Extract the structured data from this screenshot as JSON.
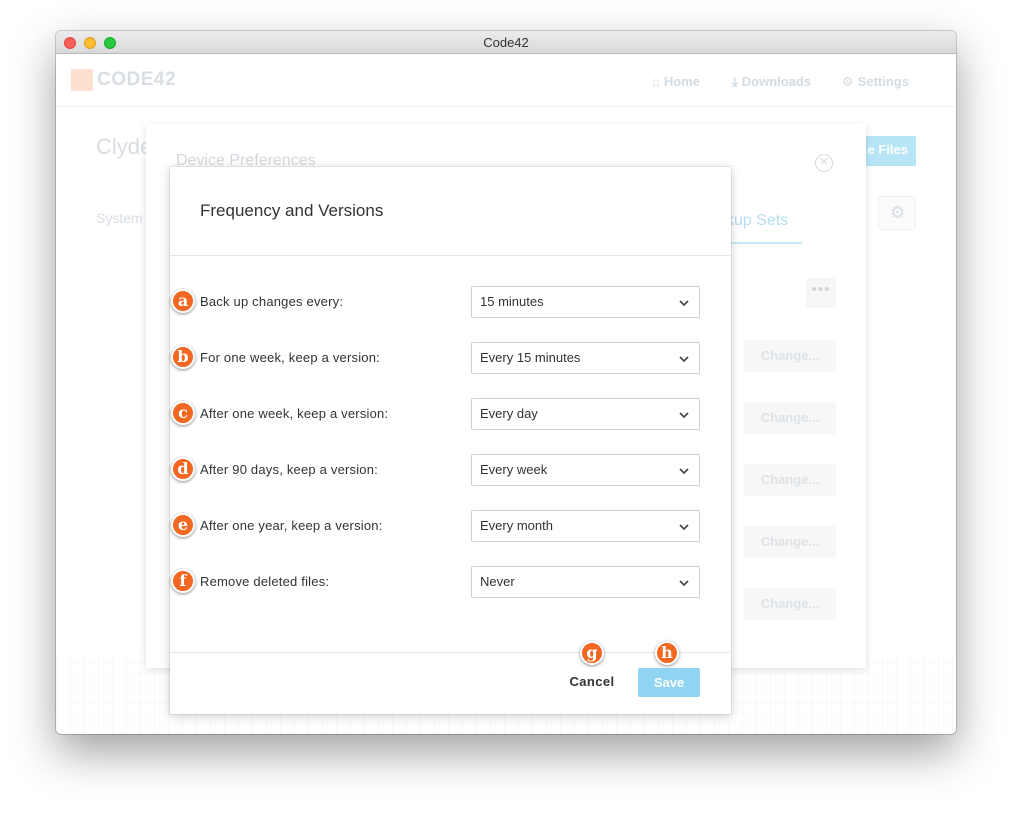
{
  "window": {
    "title": "Code42"
  },
  "app": {
    "logo_text": "CODE42",
    "nav": [
      {
        "label": "Home",
        "icon": "home-icon"
      },
      {
        "label": "Downloads",
        "icon": "download-icon"
      },
      {
        "label": "Settings",
        "icon": "settings-icon"
      }
    ],
    "device_name": "Clyde",
    "tab_system": "System",
    "files_button": "e Files"
  },
  "prefs": {
    "title": "Device Preferences",
    "tab_backup_sets": "kup Sets",
    "more_button": "•••",
    "change_label": "Change..."
  },
  "modal": {
    "title": "Frequency and Versions",
    "rows": [
      {
        "marker": "a",
        "label": "Back up changes every:",
        "value": "15 minutes"
      },
      {
        "marker": "b",
        "label": "For one week, keep a version:",
        "value": "Every 15 minutes"
      },
      {
        "marker": "c",
        "label": "After one week, keep a version:",
        "value": "Every day"
      },
      {
        "marker": "d",
        "label": "After 90 days, keep a version:",
        "value": "Every week"
      },
      {
        "marker": "e",
        "label": "After one year, keep a version:",
        "value": "Every month"
      },
      {
        "marker": "f",
        "label": "Remove deleted files:",
        "value": "Never"
      }
    ],
    "cancel_label": "Cancel",
    "save_label": "Save",
    "cancel_marker": "g",
    "save_marker": "h"
  },
  "colors": {
    "accent": "#f26722",
    "save_button": "#8fd5f1"
  }
}
